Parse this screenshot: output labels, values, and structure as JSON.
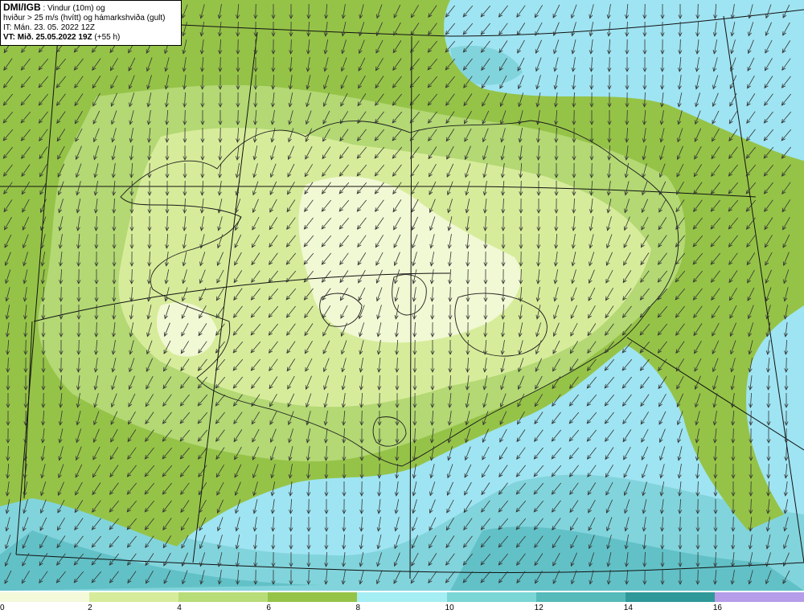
{
  "info": {
    "source": "DMI/IGB",
    "line1_rest": " : Vindur (10m) og",
    "line2": "hviður > 25 m/s (hvítt) og hámarkshviða (gult)",
    "line3": "IT: Mán. 23. 05. 2022 12Z",
    "vt_label": "VT: Mið. 25.05.2022 19Z",
    "vt_rest": " (+55 h)"
  },
  "legend": {
    "colors": [
      "#f4f9d9",
      "#d7ec9b",
      "#b8dc78",
      "#95c348",
      "#a5eef4",
      "#7bd6d6",
      "#56baba",
      "#2f9898",
      "#b59de9"
    ],
    "ticks": [
      "0",
      "2",
      "4",
      "6",
      "8",
      "10",
      "12",
      "14",
      "16"
    ]
  },
  "map": {
    "sea_color": "#9fe4f2",
    "land_colors": [
      "#8dbd42",
      "#a8d160",
      "#c4e387",
      "#e4f3b9",
      "#f6fbe2"
    ],
    "deep_sea_colors": [
      "#82d4dc",
      "#62c1c7"
    ],
    "wind_direction_deg": 200
  }
}
